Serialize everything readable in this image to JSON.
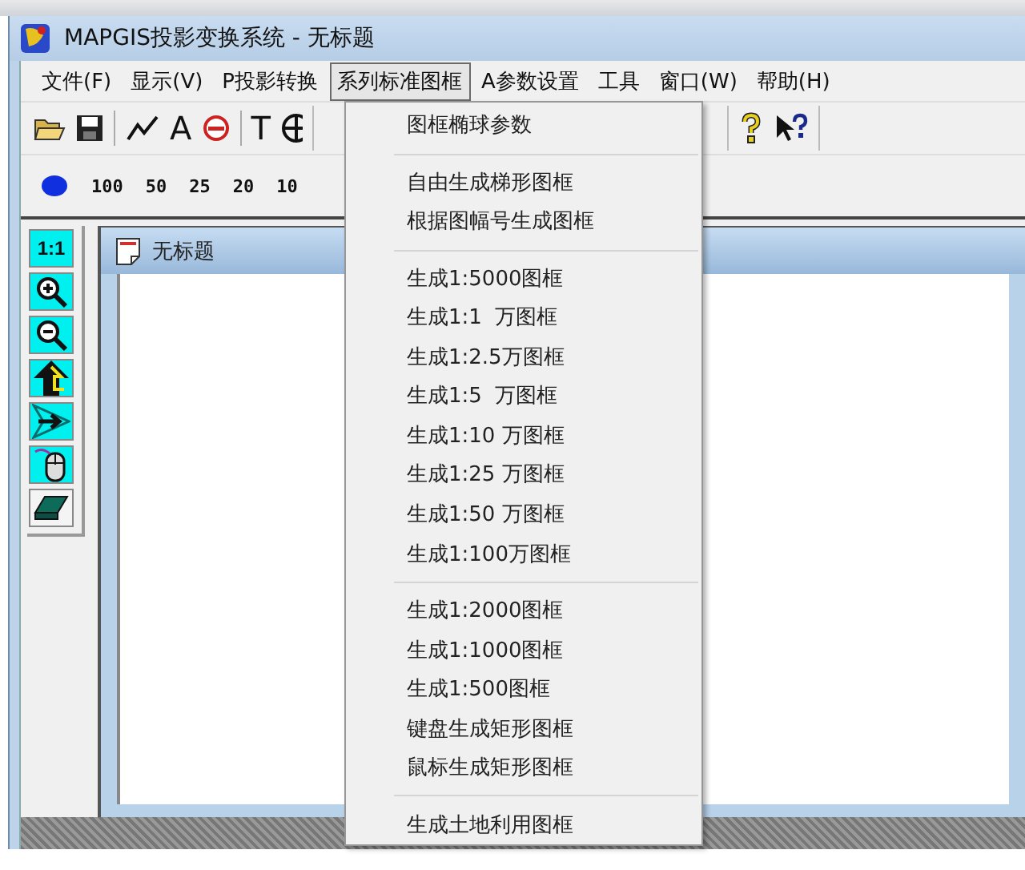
{
  "window": {
    "title": "MAPGIS投影变换系统 - 无标题"
  },
  "menu_bar": [
    {
      "label": "文件(F)",
      "selected": false
    },
    {
      "label": "显示(V)",
      "selected": false
    },
    {
      "label": "P投影转换",
      "selected": false
    },
    {
      "label": "系列标准图框",
      "selected": true
    },
    {
      "label": "A参数设置",
      "selected": false
    },
    {
      "label": "工具",
      "selected": false
    },
    {
      "label": "窗口(W)",
      "selected": false
    },
    {
      "label": "帮助(H)",
      "selected": false
    }
  ],
  "toolbar": [
    {
      "kind": "open"
    },
    {
      "kind": "save"
    },
    {
      "kind": "sep"
    },
    {
      "kind": "line"
    },
    {
      "kind": "glyph",
      "label": "A"
    },
    {
      "kind": "minus-circle"
    },
    {
      "kind": "sep"
    },
    {
      "kind": "glyph",
      "label": "T"
    },
    {
      "kind": "crosshair"
    }
  ],
  "toolbar_right": [
    {
      "kind": "help"
    },
    {
      "kind": "pointer-help"
    }
  ],
  "scale_bar": {
    "scales": [
      "100",
      "50",
      "25",
      "20",
      "10"
    ]
  },
  "side_tools": [
    {
      "kind": "text",
      "label": "1:1"
    },
    {
      "kind": "zoom-in"
    },
    {
      "kind": "zoom-out"
    },
    {
      "kind": "up-arrow"
    },
    {
      "kind": "move-arrow"
    },
    {
      "kind": "mouse"
    },
    {
      "kind": "eraser"
    }
  ],
  "document": {
    "title": "无标题"
  },
  "dropdown": {
    "groups": [
      [
        "图框椭球参数"
      ],
      [
        "自由生成梯形图框",
        "根据图幅号生成图框"
      ],
      [
        "生成1:5000图框",
        "生成1:1  万图框",
        "生成1:2.5万图框",
        "生成1:5  万图框",
        "生成1:10 万图框",
        "生成1:25 万图框",
        "生成1:50 万图框",
        "生成1:100万图框"
      ],
      [
        "生成1:2000图框",
        "生成1:1000图框",
        "生成1:500图框",
        "键盘生成矩形图框",
        "鼠标生成矩形图框"
      ],
      [
        "生成土地利用图框"
      ]
    ]
  }
}
